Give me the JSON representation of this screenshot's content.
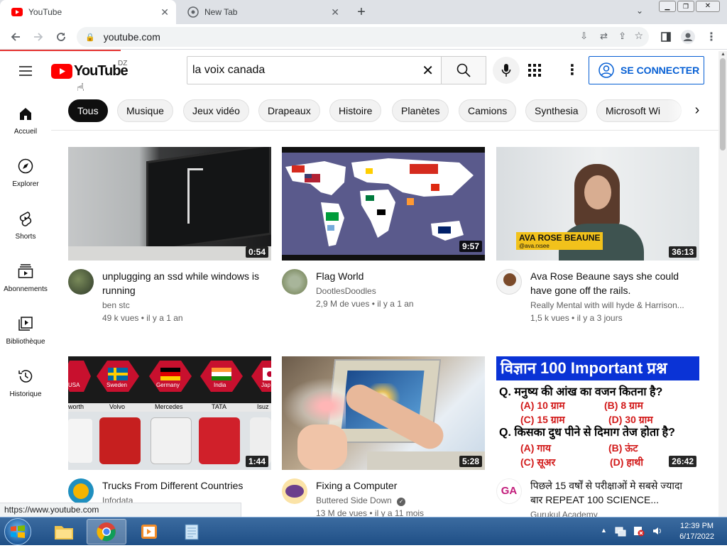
{
  "browser": {
    "tabs": [
      {
        "title": "YouTube",
        "active": true
      },
      {
        "title": "New Tab",
        "active": false
      }
    ],
    "url": "youtube.com",
    "status_url": "https://www.youtube.com"
  },
  "youtube": {
    "logo_text": "YouTube",
    "country_code": "DZ",
    "search_value": "la voix canada",
    "sign_in_label": "SE CONNECTER",
    "sidebar": [
      {
        "label": "Accueil",
        "icon": "home-icon"
      },
      {
        "label": "Explorer",
        "icon": "compass-icon"
      },
      {
        "label": "Shorts",
        "icon": "shorts-icon"
      },
      {
        "label": "Abonnements",
        "icon": "subscriptions-icon"
      },
      {
        "label": "Bibliothèque",
        "icon": "library-icon"
      },
      {
        "label": "Historique",
        "icon": "history-icon"
      }
    ],
    "chips": [
      "Tous",
      "Musique",
      "Jeux vidéo",
      "Drapeaux",
      "Histoire",
      "Planètes",
      "Camions",
      "Synthesia",
      "Microsoft Wi"
    ],
    "videos": [
      {
        "title": "unplugging an ssd while windows is running",
        "channel": "ben stc",
        "stats": "49 k vues • il y a 1 an",
        "duration": "0:54"
      },
      {
        "title": "Flag World",
        "channel": "DootlesDoodles",
        "stats": "2,9 M de vues • il y a 1 an",
        "duration": "9:57"
      },
      {
        "title": "Ava Rose Beaune says she could have gone off the rails.",
        "channel": "Really Mental with will hyde & Harrison...",
        "stats": "1,5 k vues • il y a 3 jours",
        "duration": "36:13",
        "overlay_name": "AVA ROSE BEAUNE",
        "overlay_handle": "@ava.rxsee"
      },
      {
        "title": "Trucks From Different Countries",
        "channel": "Infodata",
        "stats": "",
        "duration": "1:44",
        "countries": [
          "USA",
          "Sweden",
          "Germany",
          "India",
          "Jap"
        ],
        "brands": [
          "worth",
          "Volvo",
          "Mercedes",
          "TATA",
          "Isuz"
        ]
      },
      {
        "title": "Fixing a Computer",
        "channel": "Buttered Side Down",
        "stats": "13 M de vues • il y a 11 mois",
        "duration": "5:28"
      },
      {
        "title": "पिछले 15 वर्षों से परीक्षाओं मे सबसे ज्यादा बार REPEAT 100 SCIENCE...",
        "channel": "Gurukul Academy",
        "stats": "",
        "duration": "26:42",
        "quiz": {
          "header": "विज्ञान 100 Important प्रश्न",
          "q1": "Q. मनुष्य की आंख का वजन कितना है?",
          "a": "(A) 10 ग्राम",
          "b": "(B) 8 ग्राम",
          "c": "(C) 15 ग्राम",
          "d": "(D) 30 ग्राम",
          "q2": "Q. किसका दुध पीने से दिमाग तेज होता है?",
          "a2": "(A) गाय",
          "b2": "(B) ऊंट",
          "c2": "(C) सूअर",
          "d2": "(D) हाथी"
        }
      }
    ]
  },
  "taskbar": {
    "time": "12:39 PM",
    "date": "6/17/2022"
  },
  "colors": {
    "yt_red": "#ff0000",
    "link_blue": "#065fd4",
    "chrome_bg": "#dee1e6"
  }
}
